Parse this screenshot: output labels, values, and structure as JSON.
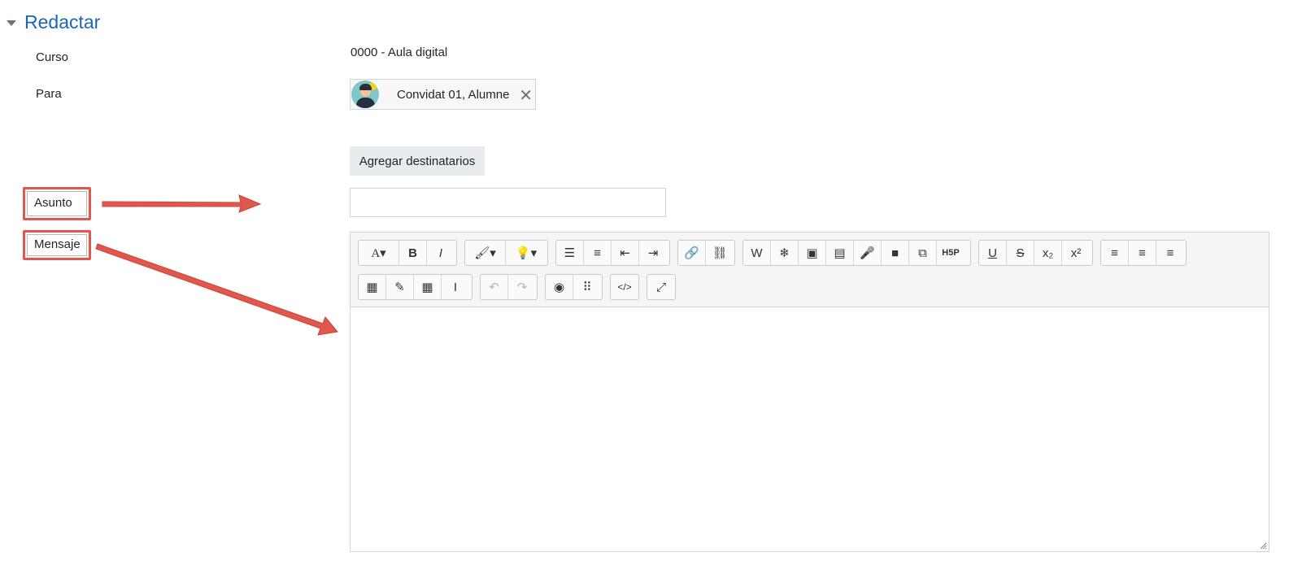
{
  "section": {
    "title": "Redactar"
  },
  "form": {
    "course_label": "Curso",
    "course_value": "0000 - Aula digital",
    "to_label": "Para",
    "recipient_name": "Convidat 01, Alumne",
    "remove_symbol": "✕",
    "add_recipients_label": "Agregar destinatarios",
    "subject_label": "Asunto",
    "subject_value": "",
    "message_label": "Mensaje"
  },
  "toolbar": {
    "row1": [
      {
        "group": "style",
        "items": [
          {
            "name": "font-style-icon",
            "glyph": "A▾",
            "wide": true
          },
          {
            "name": "bold-icon",
            "glyph": "B"
          },
          {
            "name": "italic-icon",
            "glyph": "I"
          }
        ]
      },
      {
        "group": "color",
        "items": [
          {
            "name": "paint-brush-icon",
            "glyph": "🖌▾",
            "wide": true
          },
          {
            "name": "lightbulb-icon",
            "glyph": "💡▾",
            "wide": true
          }
        ]
      },
      {
        "group": "lists",
        "items": [
          {
            "name": "unordered-list-icon",
            "glyph": "☰"
          },
          {
            "name": "ordered-list-icon",
            "glyph": "≡"
          },
          {
            "name": "outdent-icon",
            "glyph": "⇤"
          },
          {
            "name": "indent-icon",
            "glyph": "⇥"
          }
        ]
      },
      {
        "group": "links",
        "items": [
          {
            "name": "link-icon",
            "glyph": "🔗"
          },
          {
            "name": "unlink-icon",
            "glyph": "⛓"
          }
        ]
      },
      {
        "group": "media",
        "items": [
          {
            "name": "word-import-icon",
            "glyph": "W"
          },
          {
            "name": "snowflake-icon",
            "glyph": "❄"
          },
          {
            "name": "image-icon",
            "glyph": "▣"
          },
          {
            "name": "media-file-icon",
            "glyph": "▤"
          },
          {
            "name": "microphone-icon",
            "glyph": "🎤"
          },
          {
            "name": "video-camera-icon",
            "glyph": "■"
          },
          {
            "name": "copy-icon",
            "glyph": "⧉"
          },
          {
            "name": "h5p-icon",
            "glyph": "H5P"
          }
        ]
      },
      {
        "group": "format",
        "items": [
          {
            "name": "underline-icon",
            "glyph": "U"
          },
          {
            "name": "strikethrough-icon",
            "glyph": "S"
          },
          {
            "name": "subscript-icon",
            "glyph": "x₂"
          },
          {
            "name": "superscript-icon",
            "glyph": "x²"
          }
        ]
      },
      {
        "group": "align",
        "items": [
          {
            "name": "align-left-icon",
            "glyph": "≡"
          },
          {
            "name": "align-center-icon",
            "glyph": "≡"
          },
          {
            "name": "align-right-icon",
            "glyph": "≡"
          }
        ]
      }
    ],
    "row2": [
      {
        "group": "insert",
        "items": [
          {
            "name": "calculator-icon",
            "glyph": "▦"
          },
          {
            "name": "edit-icon",
            "glyph": "✎"
          },
          {
            "name": "table-icon",
            "glyph": "▦"
          },
          {
            "name": "text-cursor-icon",
            "glyph": "I"
          }
        ]
      },
      {
        "group": "history",
        "items": [
          {
            "name": "undo-icon",
            "glyph": "↶",
            "disabled": true
          },
          {
            "name": "redo-icon",
            "glyph": "↷",
            "disabled": true
          }
        ]
      },
      {
        "group": "accessibility",
        "items": [
          {
            "name": "accessibility-icon",
            "glyph": "◉"
          },
          {
            "name": "braille-icon",
            "glyph": "⠿"
          }
        ]
      },
      {
        "group": "code",
        "items": [
          {
            "name": "html-code-icon",
            "glyph": "</>"
          }
        ]
      },
      {
        "group": "fullscreen",
        "items": [
          {
            "name": "fullscreen-icon",
            "glyph": "⤢"
          }
        ]
      }
    ]
  },
  "colors": {
    "accent": "#1a66b8",
    "highlight": "#e2574c",
    "toolbar_bg": "#f5f5f5"
  }
}
